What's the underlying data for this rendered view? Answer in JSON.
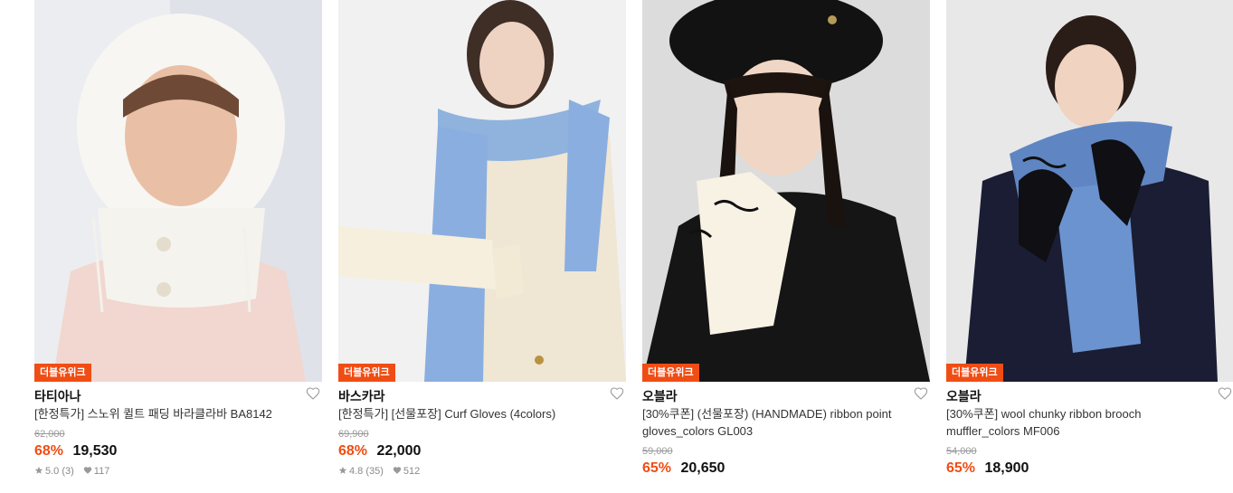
{
  "products": [
    {
      "badge": "더블유위크",
      "brand": "타티아나",
      "title": "[한정특가] 스노위 퀼트 패딩 바라클라바 BA8142",
      "original_price": "62,000",
      "discount": "68%",
      "price": "19,530",
      "rating": "5.0 (3)",
      "likes": "117"
    },
    {
      "badge": "더블유위크",
      "brand": "바스카라",
      "title": "[한정특가] [선물포장] Curf Gloves (4colors)",
      "original_price": "69,900",
      "discount": "68%",
      "price": "22,000",
      "rating": "4.8 (35)",
      "likes": "512"
    },
    {
      "badge": "더블유위크",
      "brand": "오블라",
      "title": "[30%쿠폰] (선물포장) (HANDMADE) ribbon point gloves_colors GL003",
      "original_price": "59,000",
      "discount": "65%",
      "price": "20,650"
    },
    {
      "badge": "더블유위크",
      "brand": "오블라",
      "title": "[30%쿠폰] wool chunky ribbon brooch muffler_colors MF006",
      "original_price": "54,000",
      "discount": "65%",
      "price": "18,900"
    }
  ],
  "icons": {
    "wishlist": "heart-outline-icon",
    "rating": "star-icon",
    "likes": "heart-filled-icon"
  },
  "colors": {
    "accent": "#f04d14",
    "strike": "#9a9a9a"
  }
}
